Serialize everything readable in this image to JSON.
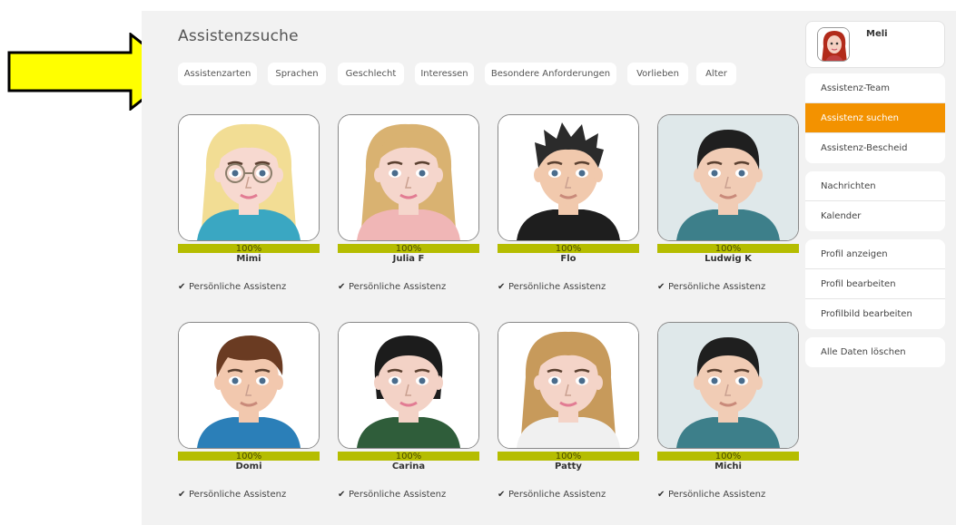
{
  "page": {
    "title": "Assistenzsuche"
  },
  "filters": [
    {
      "label": "Assistenzarten"
    },
    {
      "label": "Sprachen"
    },
    {
      "label": "Geschlecht"
    },
    {
      "label": "Interessen"
    },
    {
      "label": "Besondere Anforderungen"
    },
    {
      "label": "Vorlieben"
    },
    {
      "label": "Alter"
    }
  ],
  "assistants": [
    {
      "name": "Mimi",
      "match": "100%",
      "service": "Persönliche Assistenz",
      "avatar": {
        "gender": "female",
        "hair": "#f2dd94",
        "skin": "#f7d9d0",
        "shirt": "#3aa7c2",
        "bg": "#ffffff",
        "glasses": true,
        "style": "long"
      }
    },
    {
      "name": "Julia F",
      "match": "100%",
      "service": "Persönliche Assistenz",
      "avatar": {
        "gender": "female",
        "hair": "#d9b271",
        "skin": "#f5d6cc",
        "shirt": "#f0b6b6",
        "bg": "#ffffff",
        "glasses": false,
        "style": "long"
      }
    },
    {
      "name": "Flo",
      "match": "100%",
      "service": "Persönliche Assistenz",
      "avatar": {
        "gender": "male",
        "hair": "#2b2b2b",
        "skin": "#f1c9ad",
        "shirt": "#1e1e1e",
        "bg": "#ffffff",
        "glasses": false,
        "style": "spiky"
      }
    },
    {
      "name": "Ludwig K",
      "match": "100%",
      "service": "Persönliche Assistenz",
      "avatar": {
        "gender": "male",
        "hair": "#1f1f1f",
        "skin": "#f1ccb5",
        "shirt": "#3d7f8a",
        "bg": "#dfe8ea",
        "glasses": false,
        "style": "short"
      }
    },
    {
      "name": "Domi",
      "match": "100%",
      "service": "Persönliche Assistenz",
      "avatar": {
        "gender": "male",
        "hair": "#6a3b22",
        "skin": "#f2c8ae",
        "shirt": "#2b7fb8",
        "bg": "#ffffff",
        "glasses": false,
        "style": "swept"
      }
    },
    {
      "name": "Carina",
      "match": "100%",
      "service": "Persönliche Assistenz",
      "avatar": {
        "gender": "female",
        "hair": "#1c1c1c",
        "skin": "#f3d2c6",
        "shirt": "#2f5d3a",
        "bg": "#ffffff",
        "glasses": false,
        "style": "short"
      }
    },
    {
      "name": "Patty",
      "match": "100%",
      "service": "Persönliche Assistenz",
      "avatar": {
        "gender": "female",
        "hair": "#c79a5b",
        "skin": "#f4d4c8",
        "shirt": "#f0f0f0",
        "bg": "#ffffff",
        "glasses": false,
        "style": "long"
      }
    },
    {
      "name": "Michi",
      "match": "100%",
      "service": "Persönliche Assistenz",
      "avatar": {
        "gender": "male",
        "hair": "#1f1f1f",
        "skin": "#f1ccb5",
        "shirt": "#3d7f8a",
        "bg": "#dfe8ea",
        "glasses": false,
        "style": "short"
      }
    }
  ],
  "user": {
    "name": "Meli",
    "avatar": {
      "hair": "#b22a1a",
      "skin": "#f5d0c2",
      "shirt": "#c04040"
    }
  },
  "menu": {
    "groups": [
      [
        {
          "label": "Assistenz-Team",
          "active": false
        },
        {
          "label": "Assistenz suchen",
          "active": true
        },
        {
          "label": "Assistenz-Bescheid",
          "active": false
        }
      ],
      [
        {
          "label": "Nachrichten",
          "active": false
        },
        {
          "label": "Kalender",
          "active": false
        }
      ],
      [
        {
          "label": "Profil anzeigen",
          "active": false
        },
        {
          "label": "Profil bearbeiten",
          "active": false
        },
        {
          "label": "Profilbild bearbeiten",
          "active": false
        }
      ],
      [
        {
          "label": "Alle Daten löschen",
          "active": false
        }
      ]
    ]
  },
  "colors": {
    "accent": "#f39200",
    "match_bar": "#b5bd00",
    "arrow": "#ffff00",
    "panel": "#f2f2f2"
  }
}
